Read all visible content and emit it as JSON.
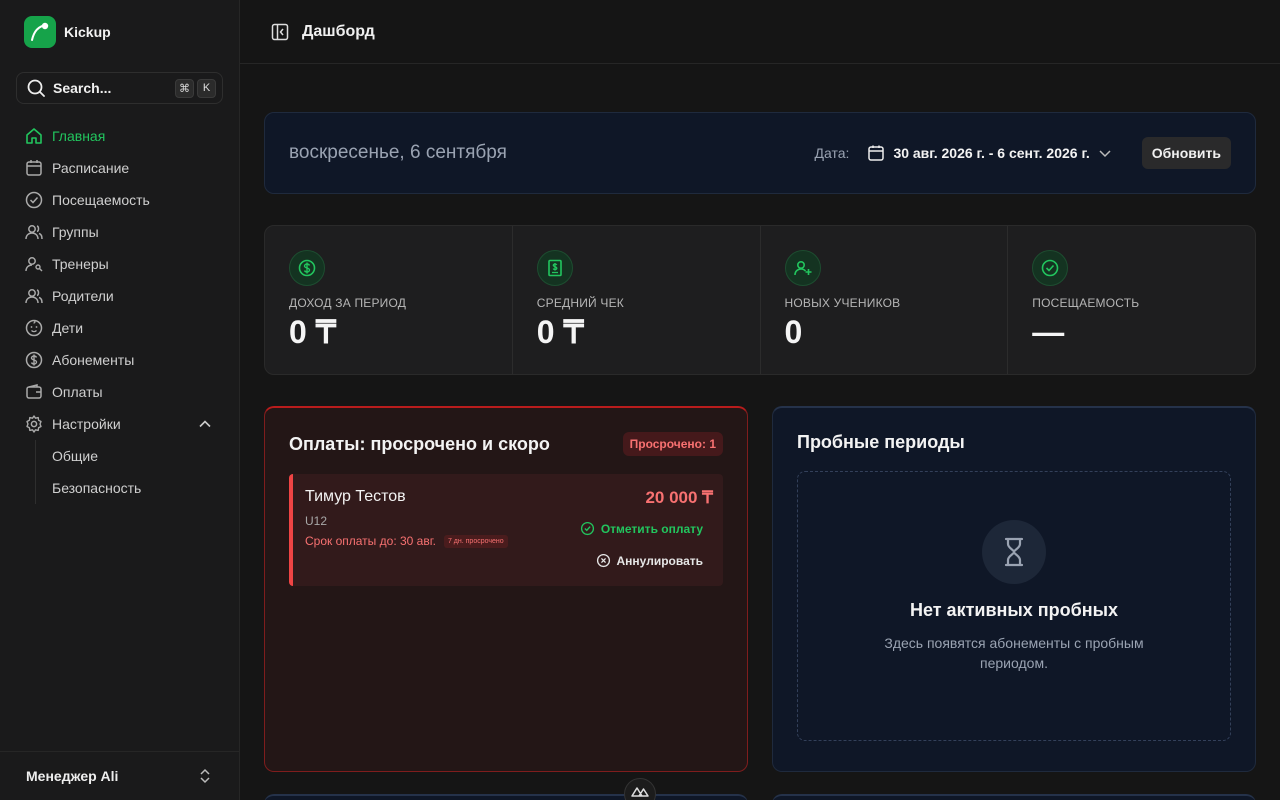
{
  "app": {
    "name": "Kickup"
  },
  "search": {
    "label": "Search...",
    "shortcut": [
      "⌘",
      "K"
    ]
  },
  "sidebar": {
    "items": [
      {
        "label": "Главная",
        "icon": "home-icon",
        "active": true
      },
      {
        "label": "Расписание",
        "icon": "calendar-icon"
      },
      {
        "label": "Посещаемость",
        "icon": "check-circle-icon"
      },
      {
        "label": "Группы",
        "icon": "users-icon"
      },
      {
        "label": "Тренеры",
        "icon": "user-key-icon"
      },
      {
        "label": "Родители",
        "icon": "users-icon"
      },
      {
        "label": "Дети",
        "icon": "baby-icon"
      },
      {
        "label": "Абонементы",
        "icon": "dollar-circle-icon"
      },
      {
        "label": "Оплаты",
        "icon": "wallet-icon"
      },
      {
        "label": "Настройки",
        "icon": "gear-icon",
        "expanded": true
      }
    ],
    "settings_sub": [
      {
        "label": "Общие"
      },
      {
        "label": "Безопасность"
      }
    ],
    "user": {
      "name": "Менеджер Ali"
    }
  },
  "header": {
    "title": "Дашборд"
  },
  "datebar": {
    "weekday": "воскресенье, 6 сентября",
    "date_label": "Дата:",
    "range": "30 авг. 2026 г. - 6 сент. 2026 г.",
    "refresh_label": "Обновить"
  },
  "stats": [
    {
      "label": "ДОХОД ЗА ПЕРИОД",
      "value": "0 ₸",
      "icon": "dollar-circle-icon"
    },
    {
      "label": "СРЕДНИЙ ЧЕК",
      "value": "0 ₸",
      "icon": "receipt-icon"
    },
    {
      "label": "НОВЫХ УЧЕНИКОВ",
      "value": "0",
      "icon": "user-plus-icon"
    },
    {
      "label": "ПОСЕЩАЕМОСТЬ",
      "value": "—",
      "icon": "check-circle-icon"
    }
  ],
  "overdue": {
    "title": "Оплаты: просрочено и скоро",
    "badge": "Просрочено: 1",
    "items": [
      {
        "name": "Тимур Тестов",
        "group": "U12",
        "due": "Срок оплаты до: 30 авг.",
        "overdue_badge": "7 дн. просрочено",
        "amount": "20 000 ₸",
        "mark_paid_label": "Отметить оплату",
        "cancel_label": "Аннулировать"
      }
    ]
  },
  "trials": {
    "title": "Пробные периоды",
    "empty_title": "Нет активных пробных",
    "empty_desc": "Здесь появятся абонементы с пробным периодом."
  },
  "colors": {
    "accent": "#22c55e",
    "danger": "#ef4444",
    "background": "#151515",
    "sidebar": "#1a1a1b"
  }
}
